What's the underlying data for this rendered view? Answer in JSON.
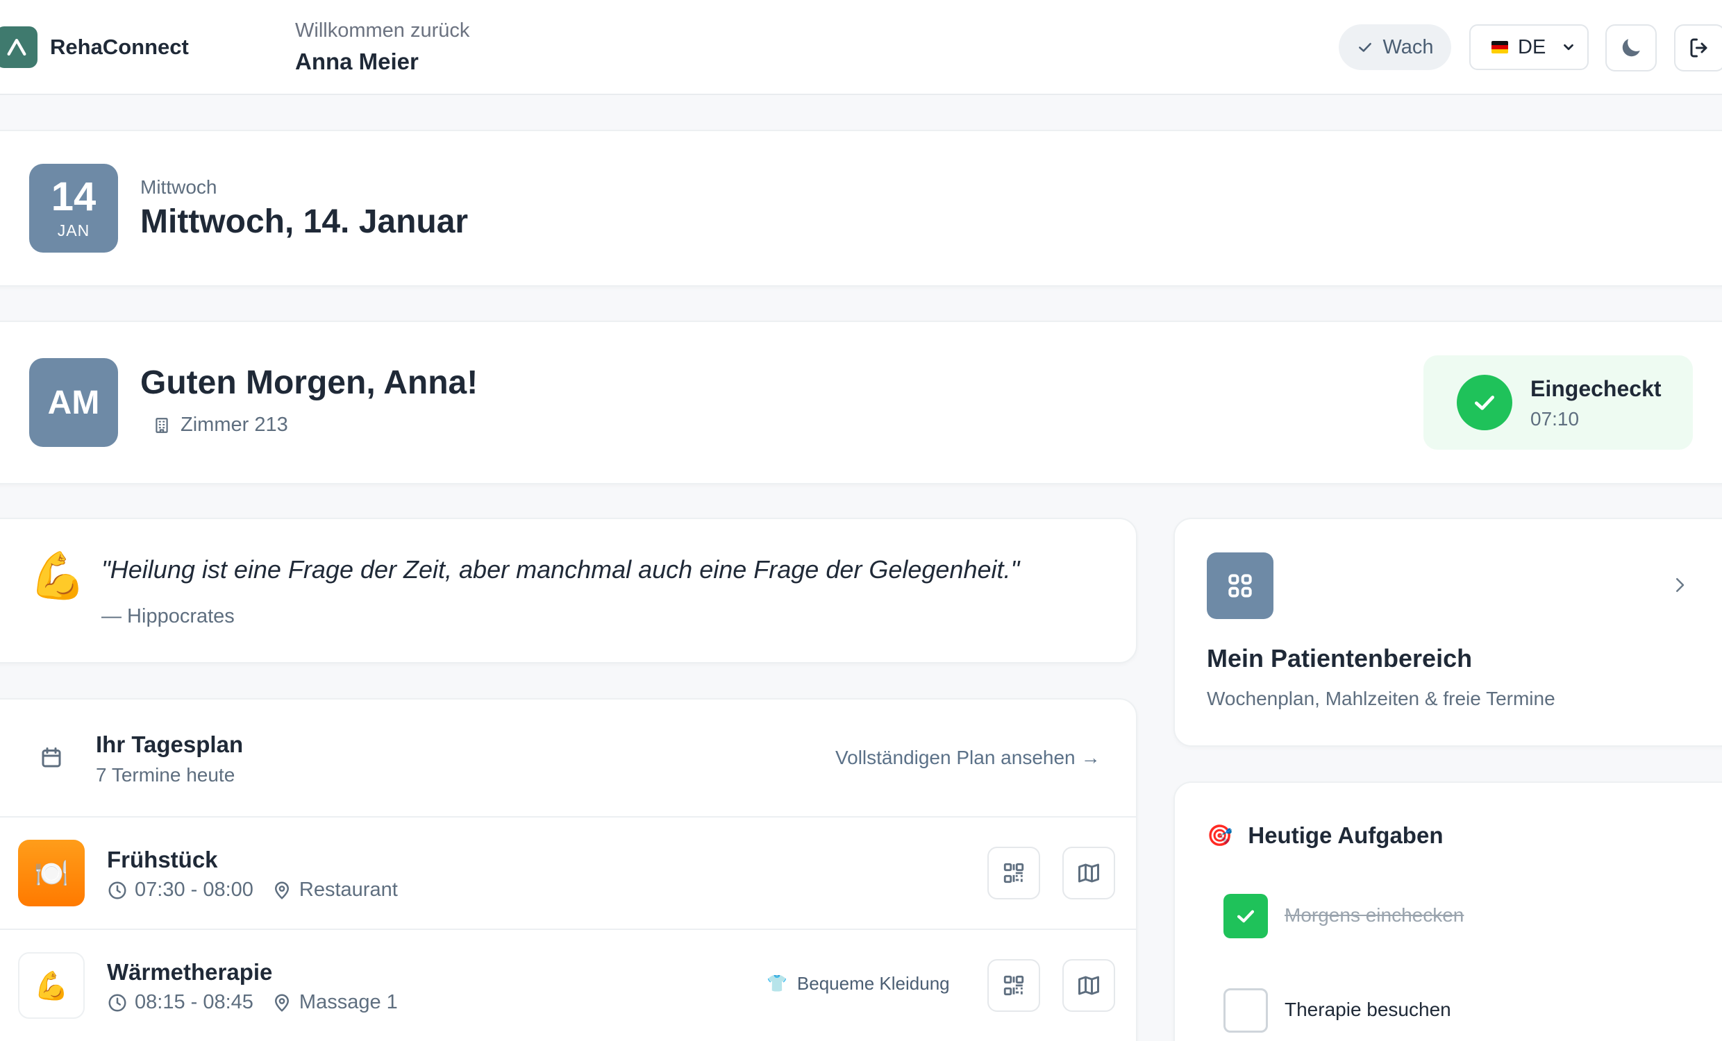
{
  "header": {
    "brand": "RehaConnect",
    "welcome": "Willkommen zurück",
    "user_name": "Anna Meier",
    "status_label": "Wach",
    "language": "DE",
    "icons": [
      "check-icon",
      "moon-icon",
      "logout-icon"
    ]
  },
  "date_card": {
    "day": "14",
    "month": "JAN",
    "weekday": "Mittwoch",
    "full_date": "Mittwoch, 14. Januar"
  },
  "greeting_card": {
    "initials": "AM",
    "greeting": "Guten Morgen, Anna!",
    "room": "Zimmer 213",
    "checkin_title": "Eingecheckt",
    "checkin_time": "07:10"
  },
  "quote": {
    "emoji": "💪",
    "text": "\"Heilung ist eine Frage der Zeit, aber manchmal auch eine Frage der Gelegenheit.\"",
    "author": "— Hippocrates"
  },
  "patient_portal": {
    "title": "Mein Patientenbereich",
    "subtitle": "Wochenplan, Mahlzeiten & freie Termine"
  },
  "plan": {
    "title": "Ihr Tagesplan",
    "count": "7 Termine heute",
    "link": "Vollständigen Plan ansehen",
    "link_arrow": "→",
    "appointments": [
      {
        "title": "Frühstück",
        "icon": "🍽️",
        "time": "07:30 - 08:00",
        "location": "Restaurant",
        "note": ""
      },
      {
        "title": "Wärmetherapie",
        "icon": "💪",
        "time": "08:15 - 08:45",
        "location": "Massage 1",
        "note": "Bequeme Kleidung",
        "note_icon": "👕"
      }
    ]
  },
  "tasks": {
    "emoji": "🎯",
    "title": "Heutige Aufgaben",
    "items": [
      {
        "label": "Morgens einchecken",
        "done": true
      },
      {
        "label": "Therapie besuchen",
        "done": false
      }
    ]
  },
  "colors": {
    "accent": "#6e8aa6",
    "brand": "#3f7a6e",
    "success": "#1fc25a",
    "success_bg": "#eefbf2",
    "breakfast": "#ff8a00"
  }
}
